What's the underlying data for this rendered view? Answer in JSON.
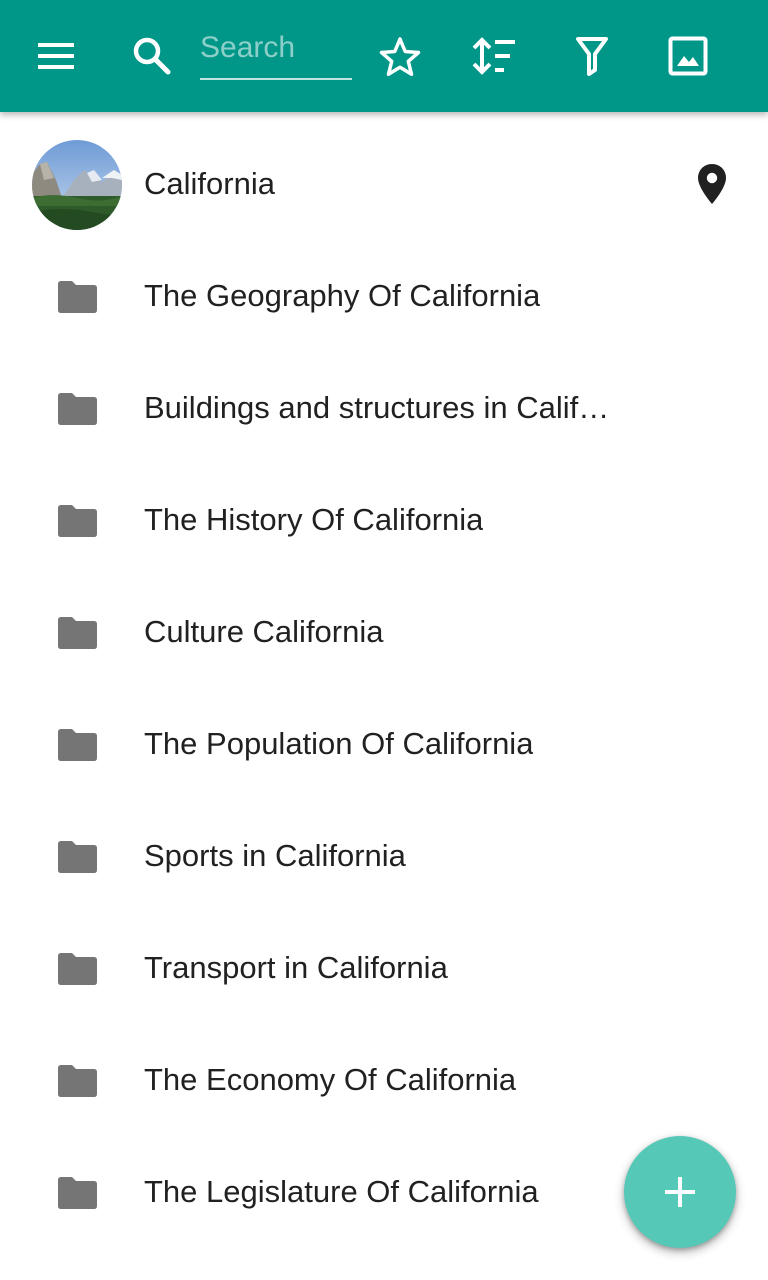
{
  "toolbar": {
    "background": "#009688",
    "search_placeholder": "Search",
    "search_value": "",
    "icons": [
      "menu-icon",
      "search-icon",
      "star-outline-icon",
      "sort-icon",
      "filter-icon",
      "image-icon"
    ]
  },
  "header_item": {
    "label": "California",
    "avatar": "yosemite-valley-photo",
    "trailing_icon": "location-pin-icon"
  },
  "categories": [
    {
      "label": "The Geography Of California",
      "icon": "folder-icon"
    },
    {
      "label": "Buildings and structures in Calif…",
      "icon": "folder-icon"
    },
    {
      "label": "The History Of California",
      "icon": "folder-icon"
    },
    {
      "label": "Culture California",
      "icon": "folder-icon"
    },
    {
      "label": "The Population Of California",
      "icon": "folder-icon"
    },
    {
      "label": "Sports in California",
      "icon": "folder-icon"
    },
    {
      "label": "Transport in California",
      "icon": "folder-icon"
    },
    {
      "label": "The Economy Of California",
      "icon": "folder-icon"
    },
    {
      "label": "The Legislature Of California",
      "icon": "folder-icon"
    }
  ],
  "fab": {
    "icon": "add-icon",
    "color": "#55c8b8"
  },
  "colors": {
    "folder": "#757575",
    "text": "#212121"
  }
}
